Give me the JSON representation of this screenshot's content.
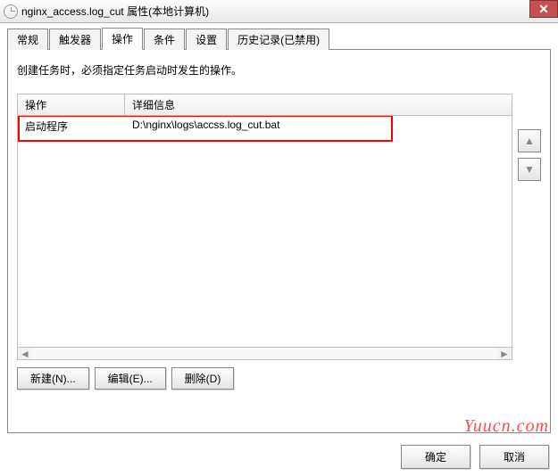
{
  "window": {
    "title": "nginx_access.log_cut 属性(本地计算机)"
  },
  "tabs": {
    "items": [
      {
        "label": "常规"
      },
      {
        "label": "触发器"
      },
      {
        "label": "操作"
      },
      {
        "label": "条件"
      },
      {
        "label": "设置"
      },
      {
        "label": "历史记录(已禁用)"
      }
    ],
    "active_index": 2
  },
  "body": {
    "description": "创建任务时，必须指定任务启动时发生的操作。"
  },
  "list": {
    "columns": {
      "action": "操作",
      "detail": "详细信息"
    },
    "rows": [
      {
        "action": "启动程序",
        "detail": "D:\\nginx\\logs\\accss.log_cut.bat"
      }
    ]
  },
  "buttons": {
    "new": "新建(N)...",
    "edit": "编辑(E)...",
    "delete": "删除(D)",
    "ok": "确定",
    "cancel": "取消"
  },
  "arrows": {
    "up": "▲",
    "down": "▼",
    "left": "◄",
    "right": "►"
  },
  "close_glyph": "✕",
  "watermark": "Yuucn.com"
}
